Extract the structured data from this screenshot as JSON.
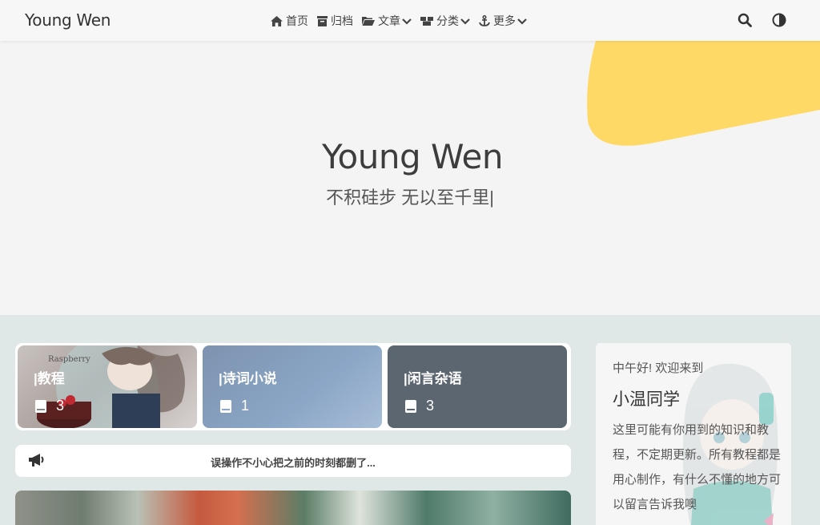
{
  "nav": {
    "brand": "Young Wen",
    "items": [
      {
        "label": "首页",
        "icon": "home-icon"
      },
      {
        "label": "归档",
        "icon": "archive-icon"
      },
      {
        "label": "文章",
        "icon": "folder-icon",
        "dropdown": true
      },
      {
        "label": "分类",
        "icon": "boxes-icon",
        "dropdown": true
      },
      {
        "label": "更多",
        "icon": "anchor-icon",
        "dropdown": true
      }
    ],
    "actions": [
      "search-icon",
      "theme-toggle-icon"
    ]
  },
  "hero": {
    "title": "Young Wen",
    "subtitle": "不积硅步 无以至千里|",
    "accent_color": "#ffd966"
  },
  "categories": [
    {
      "label": "|教程",
      "count": "3",
      "icon": "book-icon"
    },
    {
      "label": "|诗词小说",
      "count": "1",
      "icon": "book-icon"
    },
    {
      "label": "|闲言杂语",
      "count": "3",
      "icon": "book-icon"
    }
  ],
  "notice": {
    "icon": "megaphone-icon",
    "text": "误操作不小心把之前的时刻都删了..."
  },
  "sidebar": {
    "greeting": "中午好! 欢迎来到",
    "name": "小温同学",
    "description": "这里可能有你用到的知识和教程，不定期更新。所有教程都是用心制作，有什么不懂的地方可以留言告诉我噢"
  },
  "colors": {
    "content_bg": "#dfe8e6",
    "card2_bg": "#8ba6c6",
    "card3_bg": "#5c6670"
  }
}
